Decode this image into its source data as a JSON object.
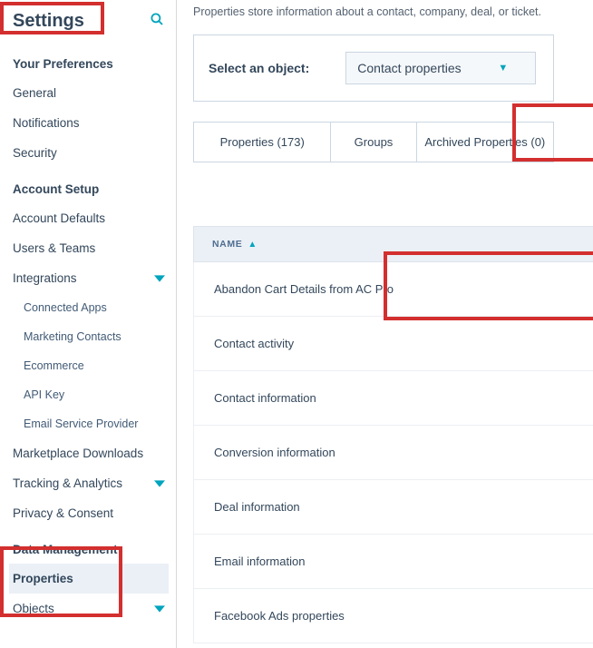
{
  "page_title": "Settings",
  "intro_text": "Properties store information about a contact, company, deal, or ticket.",
  "select_label": "Select an object:",
  "select_value": "Contact properties",
  "tabs": {
    "properties": "Properties (173)",
    "groups": "Groups",
    "archived": "Archived Properties (0)"
  },
  "table": {
    "header": "NAME",
    "rows": [
      "Abandon Cart Details from AC Pro",
      "Contact activity",
      "Contact information",
      "Conversion information",
      "Deal information",
      "Email information",
      "Facebook Ads properties"
    ]
  },
  "sidebar": {
    "sections": {
      "prefs": "Your Preferences",
      "account": "Account Setup",
      "data": "Data Management"
    },
    "items": {
      "general": "General",
      "notifications": "Notifications",
      "security": "Security",
      "account_defaults": "Account Defaults",
      "users_teams": "Users & Teams",
      "integrations": "Integrations",
      "connected_apps": "Connected Apps",
      "marketing_contacts": "Marketing Contacts",
      "ecommerce": "Ecommerce",
      "api_key": "API Key",
      "email_service_provider": "Email Service Provider",
      "marketplace_downloads": "Marketplace Downloads",
      "tracking_analytics": "Tracking & Analytics",
      "privacy_consent": "Privacy & Consent",
      "properties": "Properties",
      "objects": "Objects"
    }
  }
}
